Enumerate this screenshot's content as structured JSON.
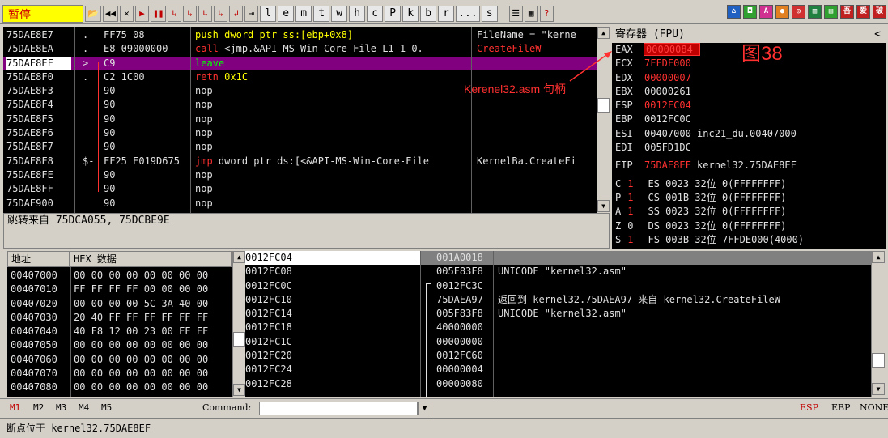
{
  "toolbar": {
    "status": "暂停",
    "buttons": [
      "📂",
      "◀◀",
      "✕",
      "▶",
      "❚❚",
      "↳",
      "↳",
      "↳",
      "↳",
      "↲",
      "⇥"
    ],
    "letters": [
      "l",
      "e",
      "m",
      "t",
      "w",
      "h",
      "c",
      "P",
      "k",
      "b",
      "r",
      "...",
      "s"
    ]
  },
  "cpu": {
    "rows": [
      {
        "addr": "75DAE8E7",
        "mark": ".",
        "hex": "FF75 08",
        "op": "push",
        "arg": "dword ptr ss:[ebp+0x8]",
        "cmt": "FileName = \"kerne"
      },
      {
        "addr": "75DAE8EA",
        "mark": ".",
        "hex": "E8 09000000",
        "op": "call",
        "arg": "<jmp.&API-MS-Win-Core-File-L1-1-0.",
        "cmt": "CreateFileW"
      },
      {
        "addr": "75DAE8EF",
        "mark": ">",
        "hex": "C9",
        "op": "leave",
        "arg": "",
        "cmt": ""
      },
      {
        "addr": "75DAE8F0",
        "mark": ".",
        "hex": "C2 1C00",
        "op": "retn",
        "arg": "0x1C",
        "cmt": ""
      },
      {
        "addr": "75DAE8F3",
        "mark": "",
        "hex": "90",
        "op": "nop",
        "arg": "",
        "cmt": ""
      },
      {
        "addr": "75DAE8F4",
        "mark": "",
        "hex": "90",
        "op": "nop",
        "arg": "",
        "cmt": ""
      },
      {
        "addr": "75DAE8F5",
        "mark": "",
        "hex": "90",
        "op": "nop",
        "arg": "",
        "cmt": ""
      },
      {
        "addr": "75DAE8F6",
        "mark": "",
        "hex": "90",
        "op": "nop",
        "arg": "",
        "cmt": ""
      },
      {
        "addr": "75DAE8F7",
        "mark": "",
        "hex": "90",
        "op": "nop",
        "arg": "",
        "cmt": ""
      },
      {
        "addr": "75DAE8F8",
        "mark": "$-",
        "hex": "FF25 E019D675",
        "op": "jmp",
        "arg": "dword ptr ds:[<&API-MS-Win-Core-File",
        "cmt": "KernelBa.CreateFi"
      },
      {
        "addr": "75DAE8FE",
        "mark": "",
        "hex": "90",
        "op": "nop",
        "arg": "",
        "cmt": ""
      },
      {
        "addr": "75DAE8FF",
        "mark": "",
        "hex": "90",
        "op": "nop",
        "arg": "",
        "cmt": ""
      },
      {
        "addr": "75DAE900",
        "mark": "",
        "hex": "90",
        "op": "nop",
        "arg": "",
        "cmt": ""
      }
    ],
    "selected_index": 2,
    "info": "跳转来自 75DCA055, 75DCBE9E"
  },
  "annotation": {
    "figure_label": "图38",
    "arrow_label": "Kerenel32.asm 句柄"
  },
  "registers": {
    "title": "寄存器 (FPU)",
    "collapse": "<",
    "rows": [
      {
        "name": "EAX",
        "value": "00000084",
        "extra": "",
        "red": true,
        "boxed": true
      },
      {
        "name": "ECX",
        "value": "7FFDF000",
        "extra": "",
        "red": true
      },
      {
        "name": "EDX",
        "value": "00000007",
        "extra": "",
        "red": true
      },
      {
        "name": "EBX",
        "value": "00000261",
        "extra": "",
        "red": false
      },
      {
        "name": "ESP",
        "value": "0012FC04",
        "extra": "",
        "red": true
      },
      {
        "name": "EBP",
        "value": "0012FC0C",
        "extra": "",
        "red": false
      },
      {
        "name": "ESI",
        "value": "00407000",
        "extra": "inc21_du.00407000",
        "red": false
      },
      {
        "name": "EDI",
        "value": "005FD1DC",
        "extra": "",
        "red": false
      }
    ],
    "eip": {
      "name": "EIP",
      "value": "75DAE8EF",
      "extra": "kernel32.75DAE8EF"
    },
    "flags": [
      {
        "f": "C",
        "v": "1",
        "seg": "ES 0023 32位 0(FFFFFFFF)"
      },
      {
        "f": "P",
        "v": "1",
        "seg": "CS 001B 32位 0(FFFFFFFF)"
      },
      {
        "f": "A",
        "v": "1",
        "seg": "SS 0023 32位 0(FFFFFFFF)"
      },
      {
        "f": "Z",
        "v": "0",
        "seg": "DS 0023 32位 0(FFFFFFFF)"
      },
      {
        "f": "S",
        "v": "1",
        "seg": "FS 003B 32位 7FFDE000(4000)"
      }
    ]
  },
  "dump": {
    "header_addr": "地址",
    "header_hex": "HEX 数据",
    "rows": [
      {
        "addr": "00407000",
        "bytes": "00 00 00 00 00 00 00 00"
      },
      {
        "addr": "00407010",
        "bytes": "FF FF FF FF 00 00 00 00"
      },
      {
        "addr": "00407020",
        "bytes": "00 00 00 00 5C 3A 40 00"
      },
      {
        "addr": "00407030",
        "bytes": "20 40 FF FF FF FF FF FF"
      },
      {
        "addr": "00407040",
        "bytes": "40 F8 12 00 23 00 FF FF"
      },
      {
        "addr": "00407050",
        "bytes": "00 00 00 00 00 00 00 00"
      },
      {
        "addr": "00407060",
        "bytes": "00 00 00 00 00 00 00 00"
      },
      {
        "addr": "00407070",
        "bytes": "00 00 00 00 00 00 00 00"
      },
      {
        "addr": "00407080",
        "bytes": "00 00 00 00 00 00 00 00"
      }
    ]
  },
  "stack_addrs": [
    "0012FC04",
    "0012FC08",
    "0012FC0C",
    "0012FC10",
    "0012FC14",
    "0012FC18",
    "0012FC1C",
    "0012FC20",
    "0012FC24",
    "0012FC28"
  ],
  "stack": {
    "rows": [
      {
        "val": "001A0018",
        "cmt": ""
      },
      {
        "val": "005F83F8",
        "cmt": "UNICODE \"kernel32.asm\""
      },
      {
        "val": "0012FC3C",
        "cmt": ""
      },
      {
        "val": "75DAEA97",
        "cmt": "返回到 kernel32.75DAEA97 来自 kernel32.CreateFileW"
      },
      {
        "val": "005F83F8",
        "cmt": "UNICODE \"kernel32.asm\""
      },
      {
        "val": "40000000",
        "cmt": ""
      },
      {
        "val": "00000000",
        "cmt": ""
      },
      {
        "val": "0012FC60",
        "cmt": ""
      },
      {
        "val": "00000004",
        "cmt": ""
      },
      {
        "val": "00000080",
        "cmt": ""
      }
    ]
  },
  "bottom": {
    "marks": [
      "M1",
      "M2",
      "M3",
      "M4",
      "M5"
    ],
    "command_label": "Command:",
    "command_value": "",
    "right": [
      "ESP",
      "EBP",
      "NONE"
    ]
  },
  "statusbar": "断点位于 kernel32.75DAE8EF"
}
